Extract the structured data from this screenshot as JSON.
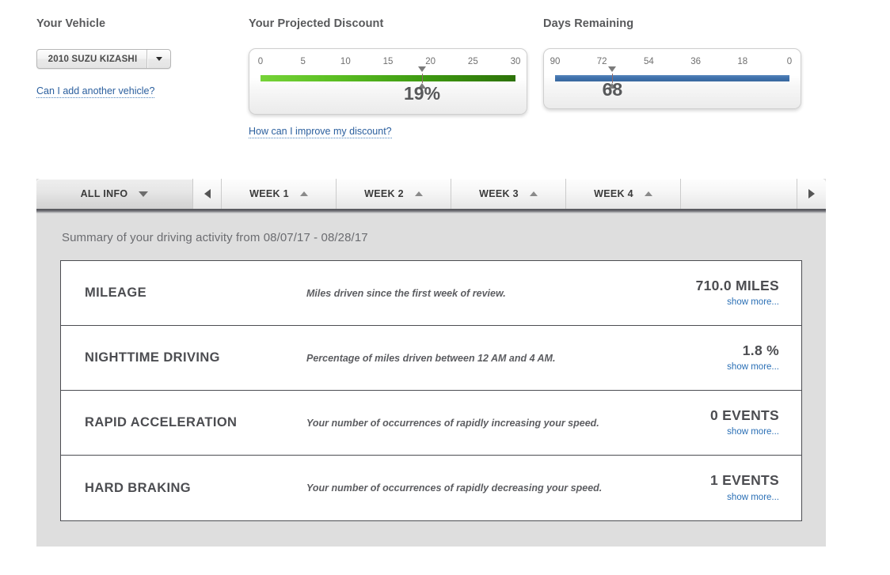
{
  "vehicle": {
    "title": "Your Vehicle",
    "selected": "2010 SUZU KIZASHI",
    "dropdown_icon": "chevron-down-icon",
    "add_vehicle_link": "Can I add another vehicle?"
  },
  "discount": {
    "title": "Your Projected Discount",
    "ticks": [
      "0",
      "5",
      "10",
      "15",
      "20",
      "25",
      "30"
    ],
    "value": "19%",
    "value_number": 19,
    "min": 0,
    "max": 30,
    "bar_color_start": "#76d338",
    "bar_color_end": "#2d7208",
    "improve_link": "How can I improve my discount?"
  },
  "days": {
    "title": "Days Remaining",
    "ticks": [
      "90",
      "72",
      "54",
      "36",
      "18",
      "0"
    ],
    "value": "68",
    "value_number": 68,
    "min": 90,
    "max": 0,
    "bar_color": "#3f71ab"
  },
  "tabs": {
    "scroll_left_icon": "chevron-left-icon",
    "scroll_right_icon": "chevron-right-icon",
    "items": [
      {
        "label": "ALL INFO",
        "icon": "chevron-down-icon",
        "active": true
      },
      {
        "label": "WEEK 1",
        "icon": "chevron-up-icon",
        "active": false
      },
      {
        "label": "WEEK 2",
        "icon": "chevron-up-icon",
        "active": false
      },
      {
        "label": "WEEK 3",
        "icon": "chevron-up-icon",
        "active": false
      },
      {
        "label": "WEEK 4",
        "icon": "chevron-up-icon",
        "active": false
      }
    ]
  },
  "summary": {
    "heading": "Summary of your driving activity from 08/07/17 - 08/28/17",
    "rows": [
      {
        "name": "MILEAGE",
        "description": "Miles driven since the first week of review.",
        "value": "710.0 MILES",
        "link": "show more..."
      },
      {
        "name": "NIGHTTIME DRIVING",
        "description": "Percentage of miles driven between 12 AM and 4 AM.",
        "value": "1.8 %",
        "link": "show more..."
      },
      {
        "name": "RAPID ACCELERATION",
        "description": "Your number of occurrences of rapidly increasing your speed.",
        "value": "0 EVENTS",
        "link": "show more..."
      },
      {
        "name": "HARD BRAKING",
        "description": "Your number of occurrences of rapidly decreasing your speed.",
        "value": "1 EVENTS",
        "link": "show more..."
      }
    ]
  }
}
